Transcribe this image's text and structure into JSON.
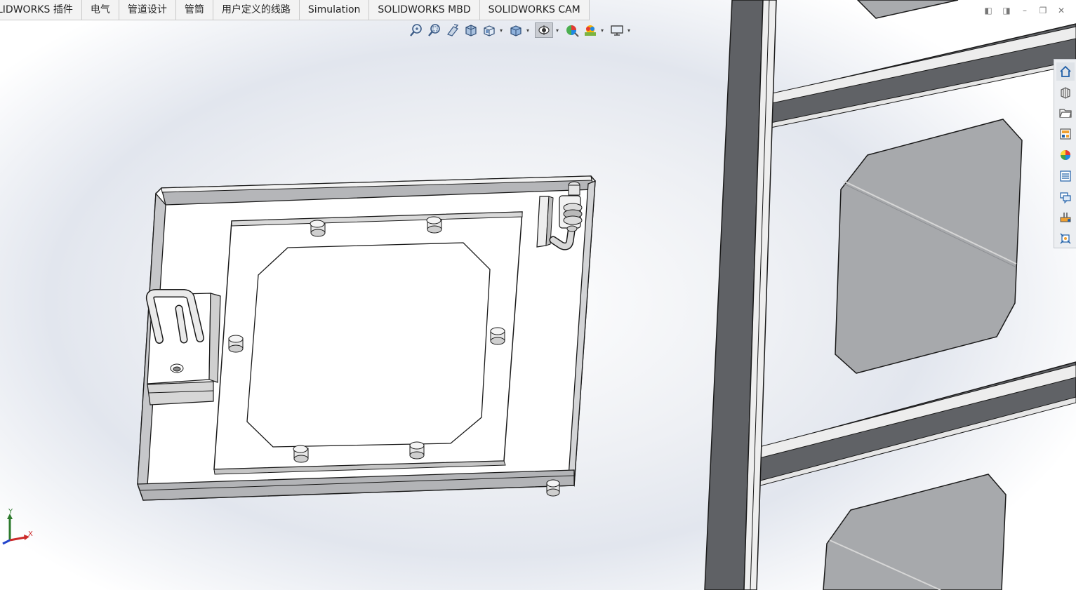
{
  "command_tabs": [
    {
      "label": "LIDWORKS 插件"
    },
    {
      "label": "电气"
    },
    {
      "label": "管道设计"
    },
    {
      "label": "管筒"
    },
    {
      "label": "用户定义的线路"
    },
    {
      "label": "Simulation"
    },
    {
      "label": "SOLIDWORKS MBD"
    },
    {
      "label": "SOLIDWORKS CAM"
    }
  ],
  "heads_up_toolbar": [
    {
      "icon": "zoom-to-fit-icon"
    },
    {
      "icon": "zoom-to-area-icon"
    },
    {
      "icon": "previous-view-icon"
    },
    {
      "icon": "section-view-icon"
    },
    {
      "icon": "view-orientation-icon"
    },
    {
      "icon": "display-style-icon"
    },
    {
      "icon": "hide-show-items-icon"
    },
    {
      "icon": "edit-appearance-icon"
    },
    {
      "icon": "apply-scene-icon"
    },
    {
      "icon": "view-settings-icon"
    }
  ],
  "task_pane": [
    {
      "icon": "solidworks-resources-icon"
    },
    {
      "icon": "design-library-icon"
    },
    {
      "icon": "file-explorer-icon"
    },
    {
      "icon": "view-palette-icon"
    },
    {
      "icon": "appearances-icon"
    },
    {
      "icon": "custom-properties-icon"
    },
    {
      "icon": "forum-icon"
    },
    {
      "icon": "solidworks-cam-icon"
    },
    {
      "icon": "dimxpert-icon"
    }
  ],
  "triad": {
    "y_label": "Y",
    "x_label": "X"
  },
  "colors": {
    "tab_bar": "#f3f3f3",
    "frame_dark": "#5f6165",
    "frame_light": "#e8e8e8",
    "panel_gray": "#a9abae",
    "outline": "#1a1a1a",
    "axis_y": "#2d7a2d",
    "axis_x": "#cc2a2a",
    "axis_z": "#2244cc"
  }
}
